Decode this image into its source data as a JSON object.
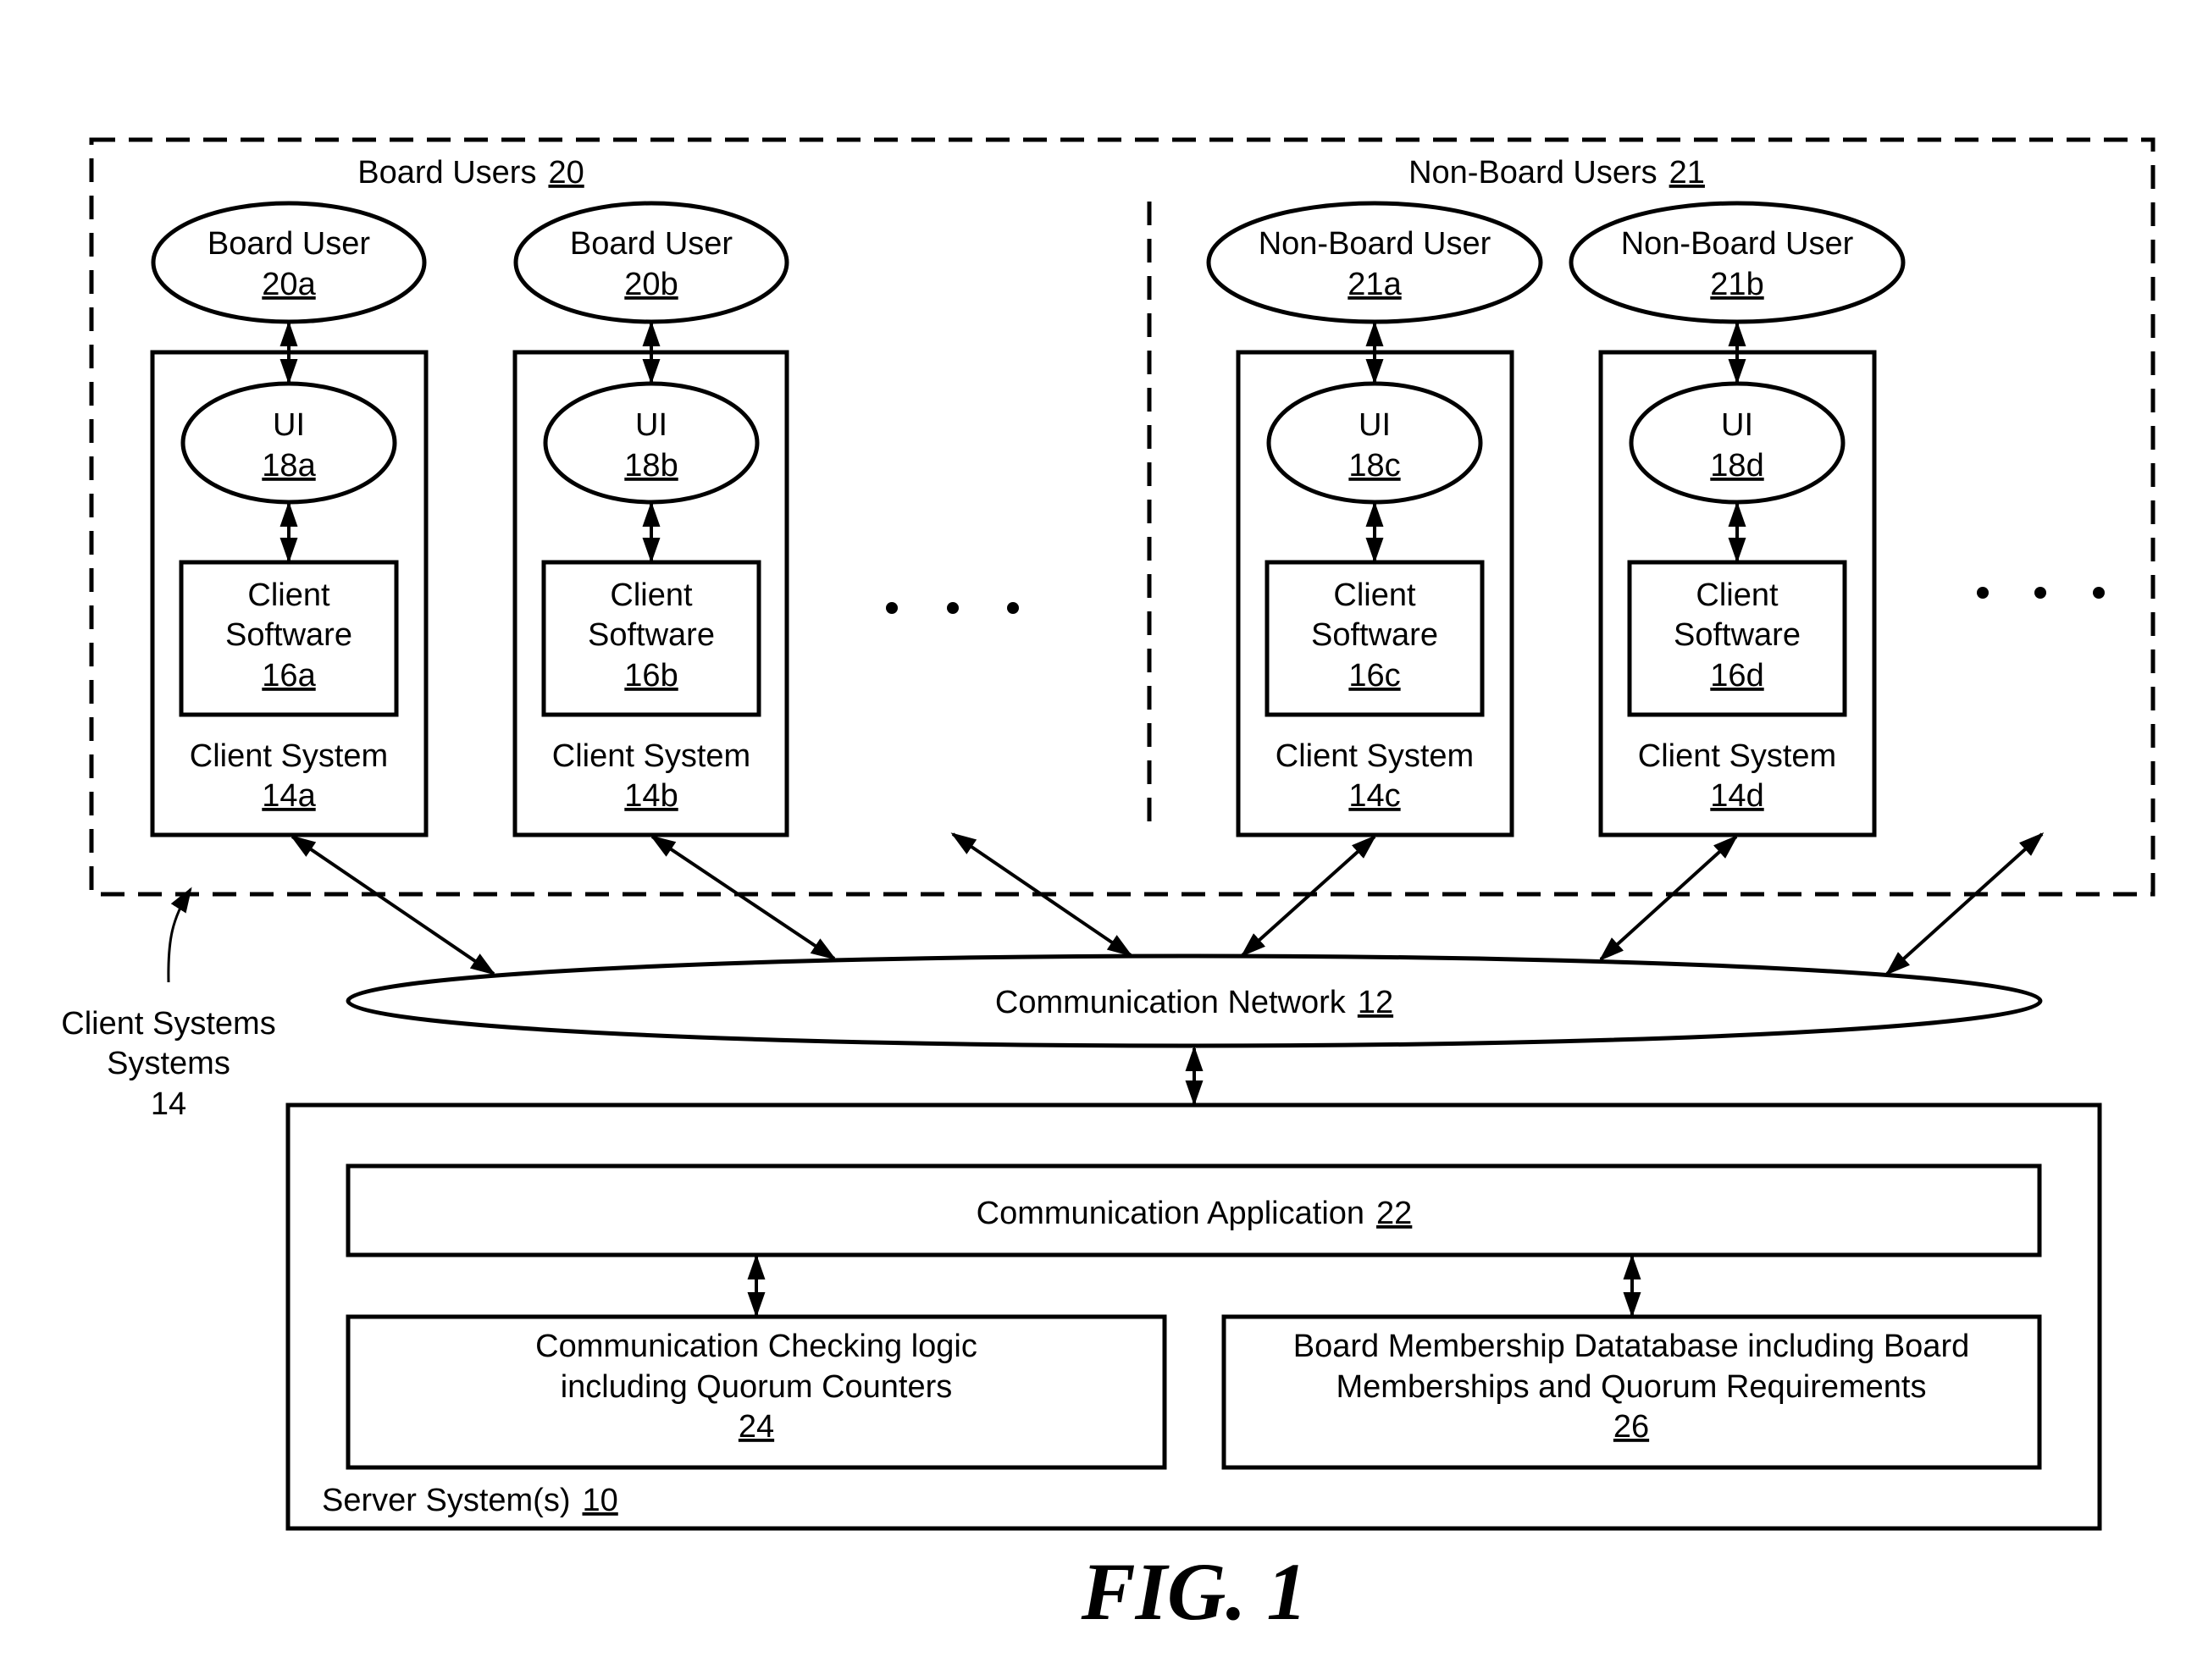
{
  "figure": {
    "caption": "FIG. 1",
    "colors": {
      "stroke": "#000000",
      "background": "#ffffff"
    }
  },
  "client_area": {
    "label": "Client Systems",
    "ref": "14",
    "board_group": {
      "label": "Board Users",
      "ref": "20"
    },
    "non_board_group": {
      "label": "Non-Board Users",
      "ref": "21"
    },
    "ellipsis": "• • •",
    "clients": [
      {
        "user_label": "Board User",
        "user_ref": "20a",
        "ui_label": "UI",
        "ui_ref": "18a",
        "software_line1": "Client",
        "software_line2": "Software",
        "software_ref": "16a",
        "system_label": "Client System",
        "system_ref": "14a"
      },
      {
        "user_label": "Board User",
        "user_ref": "20b",
        "ui_label": "UI",
        "ui_ref": "18b",
        "software_line1": "Client",
        "software_line2": "Software",
        "software_ref": "16b",
        "system_label": "Client System",
        "system_ref": "14b"
      },
      {
        "user_label": "Non-Board User",
        "user_ref": "21a",
        "ui_label": "UI",
        "ui_ref": "18c",
        "software_line1": "Client",
        "software_line2": "Software",
        "software_ref": "16c",
        "system_label": "Client System",
        "system_ref": "14c"
      },
      {
        "user_label": "Non-Board User",
        "user_ref": "21b",
        "ui_label": "UI",
        "ui_ref": "18d",
        "software_line1": "Client",
        "software_line2": "Software",
        "software_ref": "16d",
        "system_label": "Client System",
        "system_ref": "14d"
      }
    ]
  },
  "network": {
    "label": "Communication Network",
    "ref": "12"
  },
  "server": {
    "label": "Server System(s)",
    "ref": "10",
    "application": {
      "label": "Communication Application",
      "ref": "22"
    },
    "checking_logic": {
      "line1": "Communication Checking logic",
      "line2": "including Quorum Counters",
      "ref": "24"
    },
    "database": {
      "line1": "Board Membership Datatabase including Board",
      "line2": "Memberships and Quorum Requirements",
      "ref": "26"
    }
  }
}
